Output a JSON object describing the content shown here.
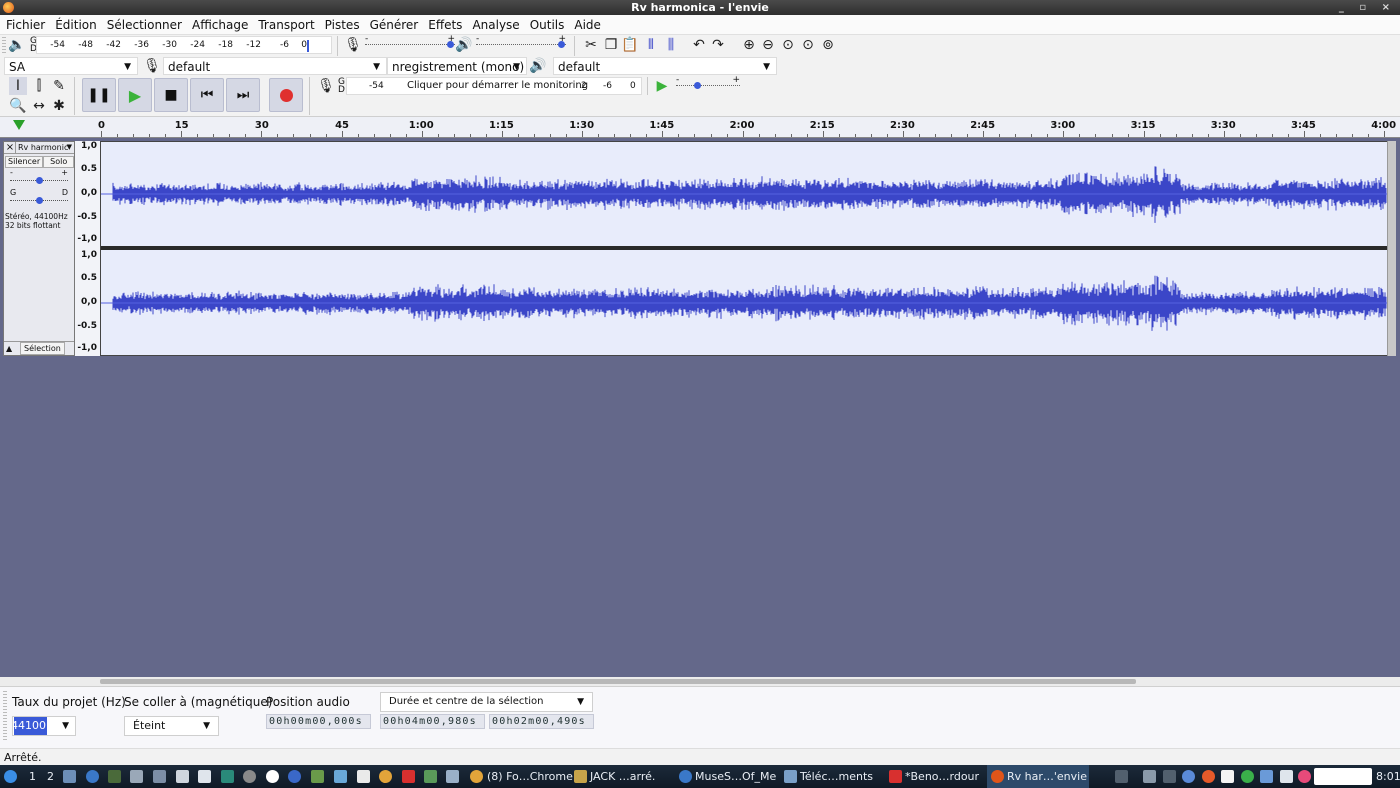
{
  "window": {
    "title": "Rv harmonica - l'envie"
  },
  "menu": [
    "Fichier",
    "Édition",
    "Sélectionner",
    "Affichage",
    "Transport",
    "Pistes",
    "Générer",
    "Effets",
    "Analyse",
    "Outils",
    "Aide"
  ],
  "meter": {
    "playback_scale": [
      "-54",
      "-48",
      "-42",
      "-36",
      "-30",
      "-24",
      "-18",
      "-12",
      "-6",
      "0"
    ],
    "record_scale": [
      "-54",
      "2",
      "-6",
      "0"
    ],
    "gd": "G\nD"
  },
  "devices": {
    "host": "SA",
    "record_device": "default",
    "channels": "nregistrement (mono)",
    "playback_device": "default"
  },
  "monitor": {
    "text": "Cliquer pour démarrer le monitoring"
  },
  "ruler": {
    "labels": [
      "0",
      "15",
      "30",
      "45",
      "1:00",
      "1:15",
      "1:30",
      "1:45",
      "2:00",
      "2:15",
      "2:30",
      "2:45",
      "3:00",
      "3:15",
      "3:30",
      "3:45",
      "4:00"
    ]
  },
  "track": {
    "name": "Rv harmonic",
    "mute": "Silencer",
    "solo": "Solo",
    "gain_minus": "-",
    "gain_plus": "+",
    "pan_left": "G",
    "pan_right": "D",
    "info_line1": "Stéréo, 44100Hz",
    "info_line2": "32 bits flottant",
    "select": "Sélection",
    "scale": [
      "1,0",
      "0.5",
      "0,0",
      "-0.5",
      "-1,0"
    ]
  },
  "selection_toolbar": {
    "rate_label": "Taux du projet (Hz)",
    "rate_value": "44100",
    "snap_label": "Se coller à (magnétique)",
    "snap_value": "Éteint",
    "audio_pos_label": "Position audio",
    "mode_value": "Durée et centre de la sélection",
    "audio_pos_time": "00h00m00,000s",
    "duration_time": "00h04m00,980s",
    "center_time": "00h02m00,490s"
  },
  "status": {
    "text": "Arrêté."
  },
  "taskbar": {
    "workspaces": [
      "1",
      "2"
    ],
    "windows": [
      {
        "label": "(8) Fo…Chrome",
        "icon": "chrome-icon"
      },
      {
        "label": "JACK …arré.",
        "icon": "jack-icon"
      },
      {
        "label": "MuseS…Of_Me",
        "icon": "musescore-icon"
      },
      {
        "label": "Téléc…ments",
        "icon": "folder-icon"
      },
      {
        "label": "*Beno…rdour",
        "icon": "ardour-icon"
      },
      {
        "label": "Rv har…'envie",
        "icon": "audacity-icon"
      }
    ],
    "clock": "8:01"
  },
  "colors": {
    "waveform": "#3b46c8",
    "waveform_peak": "#5561e0",
    "wave_bg": "#e8ecfb",
    "empty_bg": "#64688a",
    "record": "#e0302f",
    "play": "#3bb33b"
  }
}
